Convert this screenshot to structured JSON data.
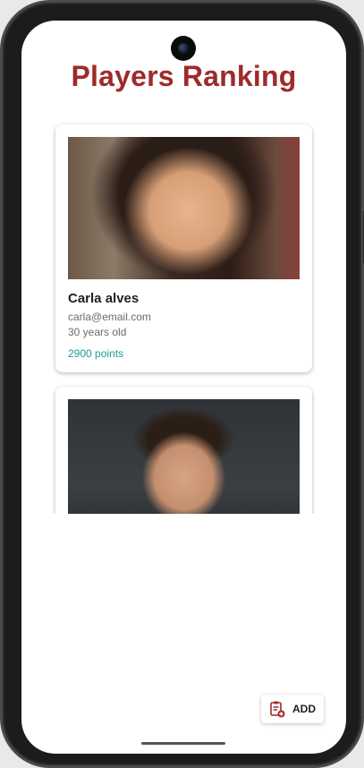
{
  "header": {
    "title": "Players Ranking"
  },
  "players": [
    {
      "name": "Carla alves",
      "email": "carla@email.com",
      "age": "30 years old",
      "points": "2900 points",
      "photo": "woman-portrait"
    },
    {
      "name": "",
      "email": "",
      "age": "",
      "points": "",
      "photo": "man-portrait"
    }
  ],
  "fab": {
    "label": "ADD",
    "icon": "clipboard-add-icon"
  },
  "colors": {
    "title": "#9e2a2b",
    "points": "#1e9a9b",
    "icon": "#9e2a2b"
  }
}
